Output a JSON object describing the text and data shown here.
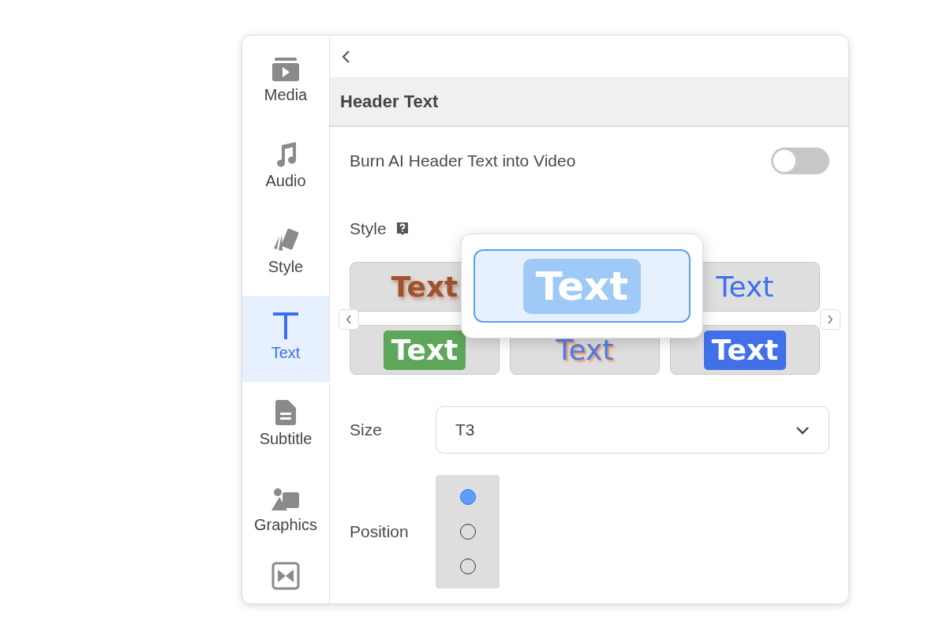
{
  "sidebar": {
    "items": [
      {
        "label": "Media",
        "selected": false
      },
      {
        "label": "Audio",
        "selected": false
      },
      {
        "label": "Style",
        "selected": false
      },
      {
        "label": "Text",
        "selected": true
      },
      {
        "label": "Subtitle",
        "selected": false
      },
      {
        "label": "Graphics",
        "selected": false
      },
      {
        "selected": false
      }
    ]
  },
  "panel": {
    "title": "Header Text",
    "burn_toggle": {
      "label": "Burn AI Header Text into Video",
      "on": false
    },
    "style": {
      "label": "Style",
      "options": [
        {
          "text": "Text",
          "kind": "shadow",
          "color": "#a0522d",
          "selected": false
        },
        {
          "text": "Text",
          "kind": "badge",
          "color": "#9fcaf8",
          "selected": true
        },
        {
          "text": "Text",
          "kind": "plain",
          "color": "#3f6ff0",
          "selected": false
        },
        {
          "text": "Text",
          "kind": "badge",
          "color": "#5ea75a",
          "selected": false
        },
        {
          "text": "Text",
          "kind": "glow",
          "color": "#4a7ef0",
          "selected": false
        },
        {
          "text": "Text",
          "kind": "badge",
          "color": "#4170e8",
          "selected": false
        }
      ]
    },
    "size": {
      "label": "Size",
      "value": "T3"
    },
    "position": {
      "label": "Position",
      "options": [
        {
          "selected": true
        },
        {
          "selected": false
        },
        {
          "selected": false
        }
      ]
    }
  }
}
